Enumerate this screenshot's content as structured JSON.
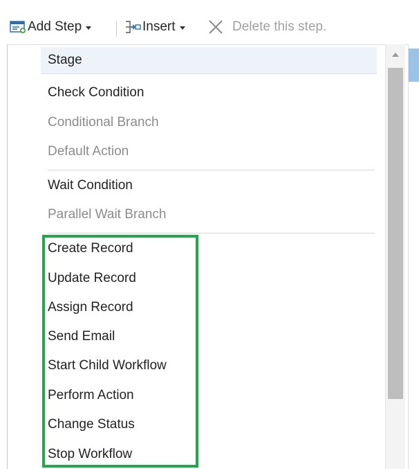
{
  "toolbar": {
    "add_step_label": "Add Step",
    "insert_label": "Insert",
    "delete_label": "Delete this step."
  },
  "menu": {
    "items": [
      {
        "label": "Stage",
        "enabled": true
      },
      {
        "label": "Check Condition",
        "enabled": true
      },
      {
        "label": "Conditional Branch",
        "enabled": false
      },
      {
        "label": "Default Action",
        "enabled": false
      },
      {
        "label": "Wait Condition",
        "enabled": true
      },
      {
        "label": "Parallel Wait Branch",
        "enabled": false
      },
      {
        "label": "Create Record",
        "enabled": true
      },
      {
        "label": "Update Record",
        "enabled": true
      },
      {
        "label": "Assign Record",
        "enabled": true
      },
      {
        "label": "Send Email",
        "enabled": true
      },
      {
        "label": "Start Child Workflow",
        "enabled": true
      },
      {
        "label": "Perform Action",
        "enabled": true
      },
      {
        "label": "Change Status",
        "enabled": true
      },
      {
        "label": "Stop Workflow",
        "enabled": true
      }
    ]
  },
  "colors": {
    "highlight_box": "#1fa94a",
    "hover_row": "#eef3fa",
    "accent_blue": "#9bc3e8"
  }
}
